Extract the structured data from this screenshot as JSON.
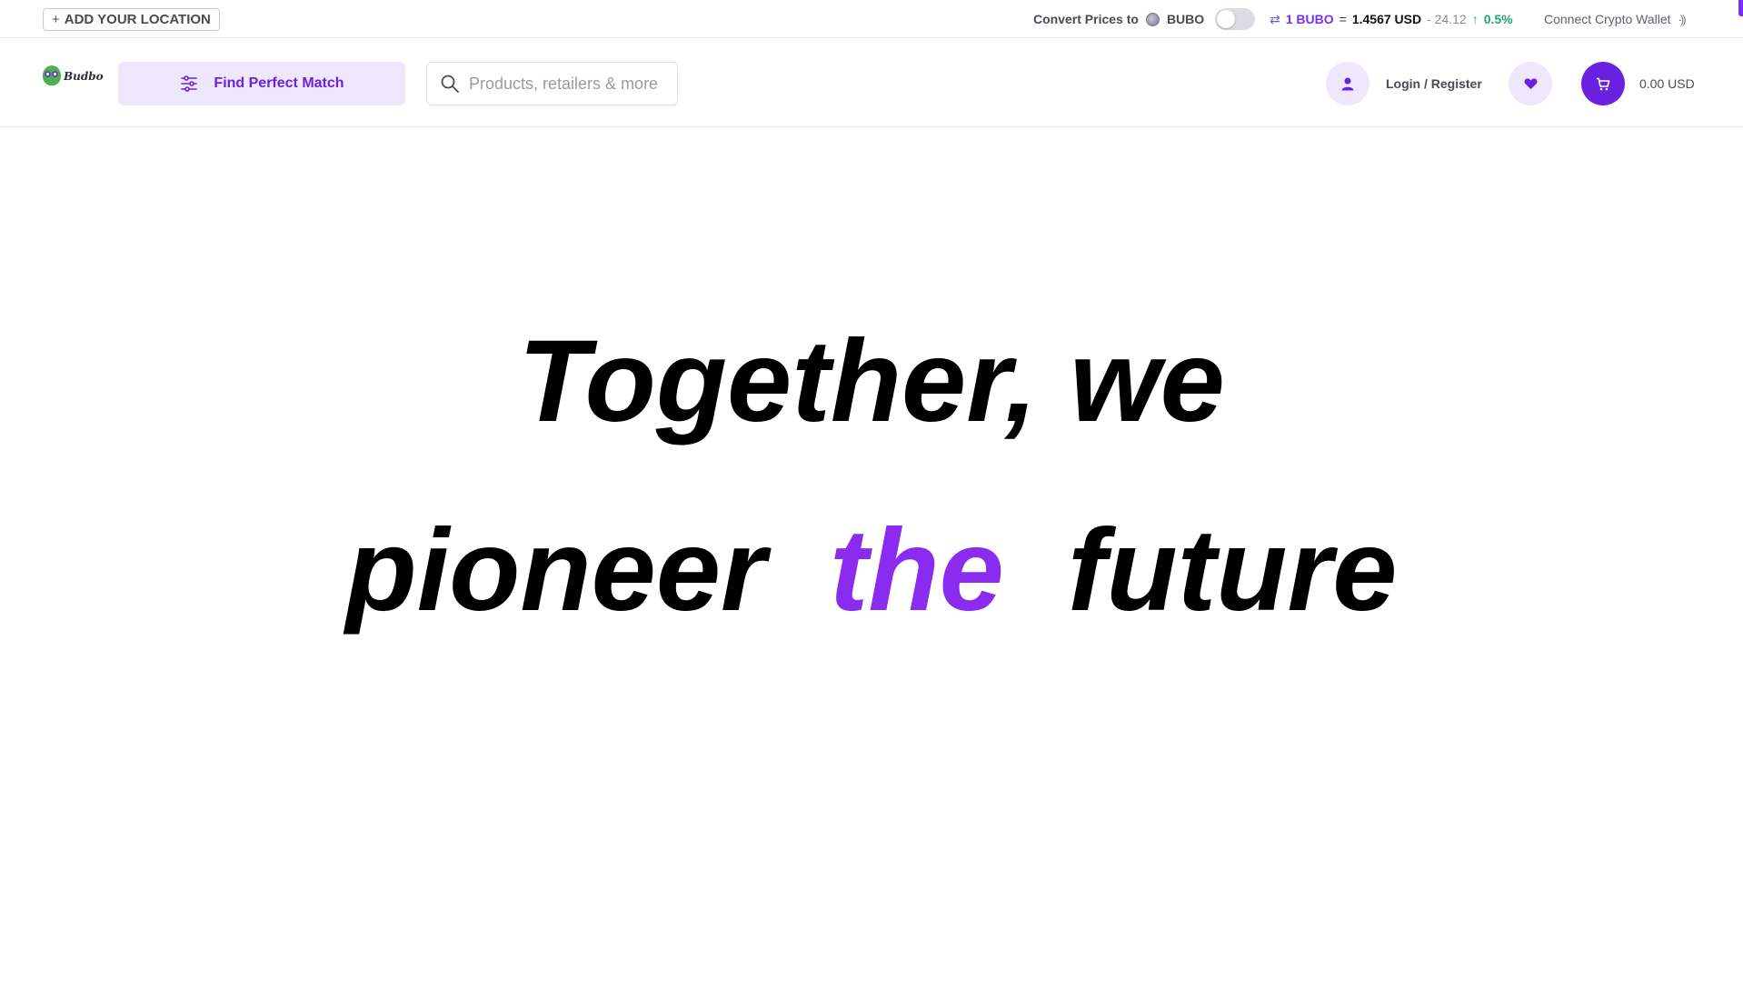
{
  "topbar": {
    "location_button": "ADD YOUR LOCATION",
    "location_plus": "+",
    "convert_label": "Convert Prices to",
    "convert_currency": "BUBO",
    "convert_toggle_on": false,
    "rate": {
      "base": "1 BUBO",
      "equals": "=",
      "value": "1.4567 USD",
      "change_abs": "- 24.12",
      "change_pct": "0.5%",
      "direction": "up"
    },
    "wallet_label": "Connect Crypto Wallet"
  },
  "header": {
    "logo_text": "Budbo",
    "match_button": "Find Perfect Match",
    "search": {
      "placeholder": "Products, retailers & more",
      "value": ""
    },
    "account_label": "Login / Register",
    "cart_total": "0.00 USD"
  },
  "hero": {
    "line1": "Together, we",
    "line2_part1": "pioneer",
    "line2_accent": "the",
    "line2_part2": "future"
  },
  "colors": {
    "brand": "#6a22e0",
    "accent_word": "#8a2bf0",
    "positive": "#1fa37a",
    "tint": "#efe8fd"
  },
  "icons": [
    "plus-icon",
    "coin-icon",
    "swap-icon",
    "arrow-up-icon",
    "signal-icon",
    "sliders-icon",
    "search-icon",
    "user-icon",
    "heart-icon",
    "cart-icon"
  ]
}
